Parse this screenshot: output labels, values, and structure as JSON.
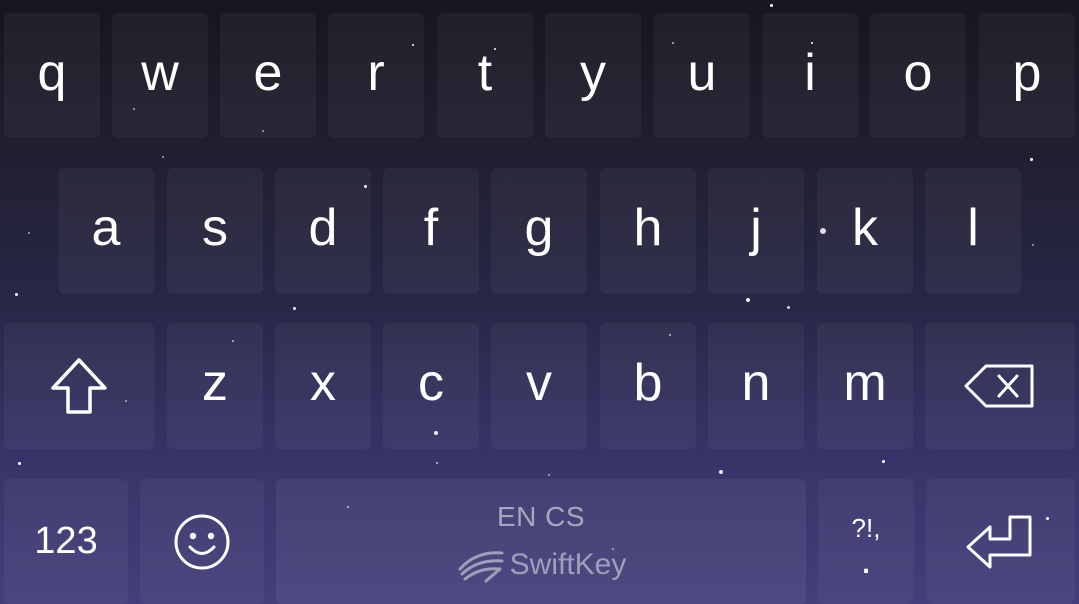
{
  "keyboard": {
    "row1": [
      "q",
      "w",
      "e",
      "r",
      "t",
      "y",
      "u",
      "i",
      "o",
      "p"
    ],
    "row2": [
      "a",
      "s",
      "d",
      "f",
      "g",
      "h",
      "j",
      "k",
      "l"
    ],
    "row3": [
      "z",
      "x",
      "c",
      "v",
      "b",
      "n",
      "m"
    ],
    "numbers_label": "123",
    "language_label": "EN CS",
    "brand_label": "SwiftKey",
    "punct_top": "?!,",
    "punct_bottom": ".",
    "icons": {
      "shift": "shift-arrow-up-icon",
      "backspace": "backspace-icon",
      "emoji": "smiley-face-icon",
      "enter": "enter-return-icon",
      "brand": "swiftkey-logo-icon"
    },
    "colors": {
      "key_text": "#ffffff",
      "space_text": "#a7a6bf",
      "gradient_top": "#16161f",
      "gradient_bottom": "#423f7a"
    }
  }
}
